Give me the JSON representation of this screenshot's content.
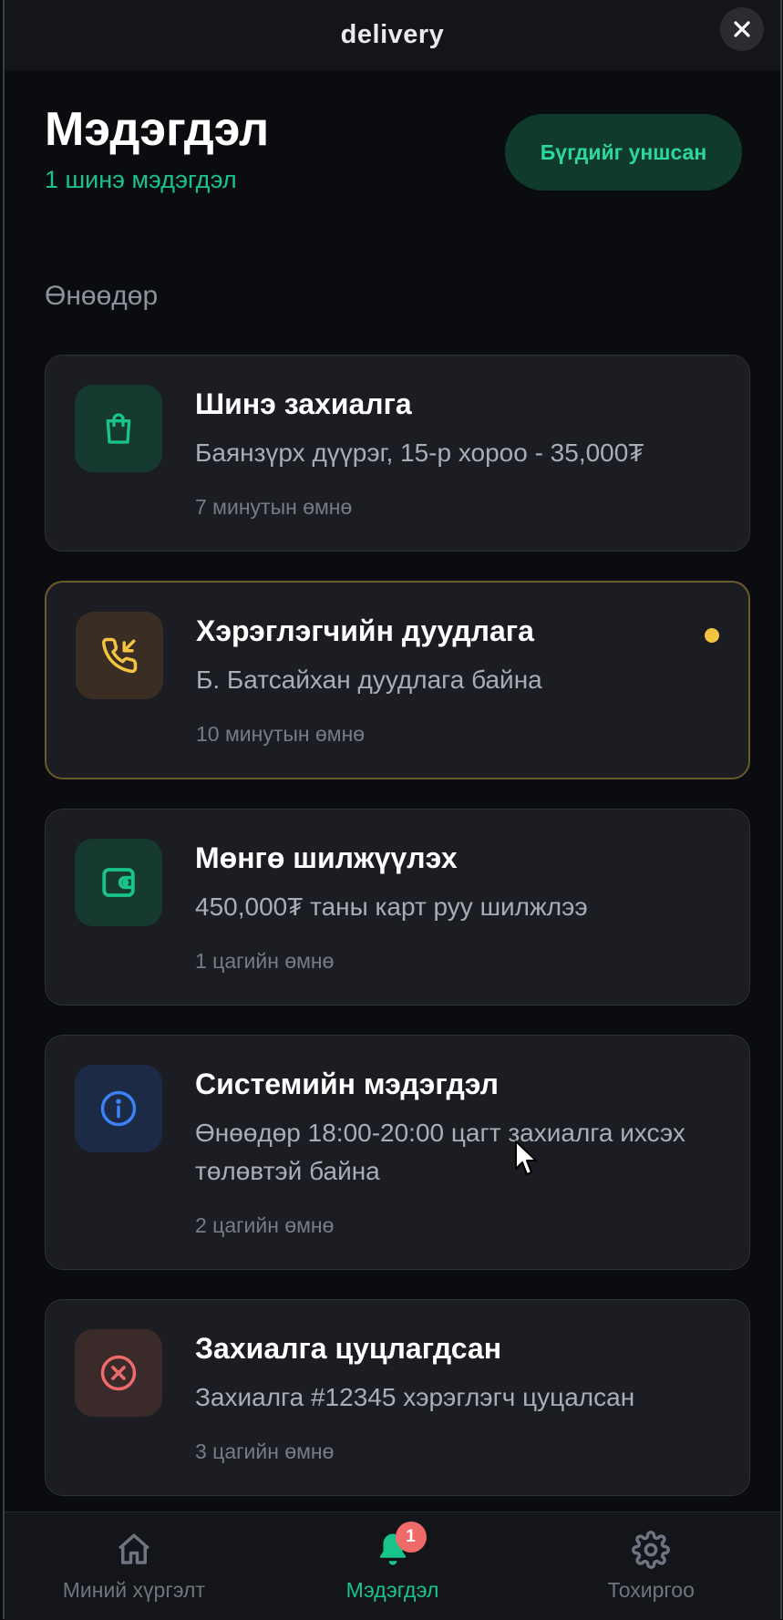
{
  "window": {
    "title": "delivery"
  },
  "header": {
    "title": "Мэдэгдэл",
    "subtitle": "1 шинэ мэдэгдэл",
    "mark_all_label": "Бүгдийг уншсан"
  },
  "section": {
    "label": "Өнөөдөр"
  },
  "notifications": [
    {
      "title": "Шинэ захиалга",
      "body": "Баянзүрх дүүрэг, 15-р хороо - 35,000₮",
      "time": "7 минутын өмнө",
      "icon": "shopping-bag-icon",
      "accent": "#19c48b",
      "unread": false
    },
    {
      "title": "Хэрэглэгчийн дуудлага",
      "body": "Б. Батсайхан дуудлага байна",
      "time": "10 минутын өмнө",
      "icon": "incoming-call-icon",
      "accent": "#f5c342",
      "unread": true
    },
    {
      "title": "Мөнгө шилжүүлэх",
      "body": "450,000₮ таны карт руу шилжлээ",
      "time": "1 цагийн өмнө",
      "icon": "wallet-icon",
      "accent": "#19c48b",
      "unread": false
    },
    {
      "title": "Системийн мэдэгдэл",
      "body": "Өнөөдөр 18:00-20:00 цагт захиалга ихсэх төлөвтэй байна",
      "time": "2 цагийн өмнө",
      "icon": "info-icon",
      "accent": "#3b82f6",
      "unread": false
    },
    {
      "title": "Захиалга цуцлагдсан",
      "body": "Захиалга #12345 хэрэглэгч цуцалсан",
      "time": "3 цагийн өмнө",
      "icon": "cancel-circle-icon",
      "accent": "#ef6b6b",
      "unread": false
    }
  ],
  "nav": {
    "items": [
      {
        "label": "Миний хүргэлт",
        "icon": "home-icon"
      },
      {
        "label": "Мэдэгдэл",
        "icon": "bell-icon",
        "badge": "1",
        "active": true
      },
      {
        "label": "Тохиргоо",
        "icon": "gear-icon"
      }
    ]
  },
  "colors": {
    "accent_green": "#19c48b",
    "background": "#0b0c0f",
    "card": "#1b1d23"
  }
}
